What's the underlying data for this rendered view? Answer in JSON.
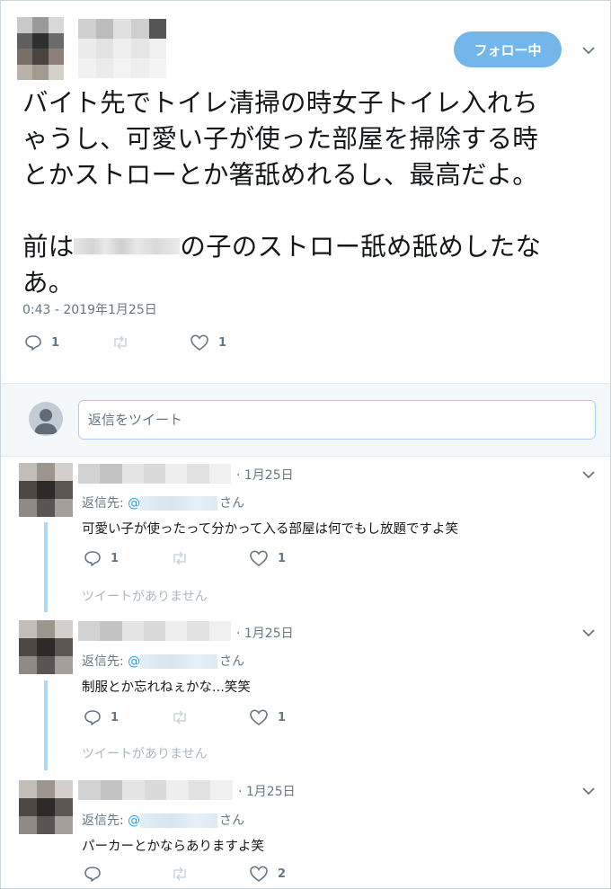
{
  "main_tweet": {
    "follow_label": "フォロー中",
    "text_line1": "バイト先でトイレ清掃の時女子トイレ入れち",
    "text_line2": "ゃうし、可愛い子が使った部屋を掃除する時",
    "text_line3": "とかストローとか箸舐めれるし、最高だよ。",
    "text_line4_pre": "前は",
    "text_line4_post": "の子のストロー舐め舐めしたな",
    "text_line5": "あ。",
    "timestamp": "0:43 - 2019年1月25日",
    "reply_count": "1",
    "retweet_count": "",
    "like_count": "1"
  },
  "reply_box": {
    "placeholder": "返信をツイート"
  },
  "replies": [
    {
      "date": "· 1月25日",
      "reply_to_prefix": "返信先: ",
      "reply_to_at": "@",
      "reply_to_suffix": "さん",
      "text": "可愛い子が使ったって分かって入る部屋は何でもし放題ですよ笑",
      "reply_count": "1",
      "like_count": "1",
      "no_tweet": "ツイートがありません"
    },
    {
      "date": "· 1月25日",
      "reply_to_prefix": "返信先: ",
      "reply_to_at": "@",
      "reply_to_suffix": "さん",
      "text": "制服とか忘れねぇかな...笑笑",
      "reply_count": "1",
      "like_count": "1",
      "no_tweet": "ツイートがありません"
    },
    {
      "date": "· 1月25日",
      "reply_to_prefix": "返信先: ",
      "reply_to_at": "@",
      "reply_to_suffix": "さん",
      "text": "パーカーとかならありますよ笑",
      "reply_count": "",
      "like_count": "2"
    }
  ],
  "colors": {
    "accent": "#1da1f2",
    "follow_bg": "#73b6ec",
    "secondary_text": "#657786",
    "thread_line": "#aed8f6"
  }
}
